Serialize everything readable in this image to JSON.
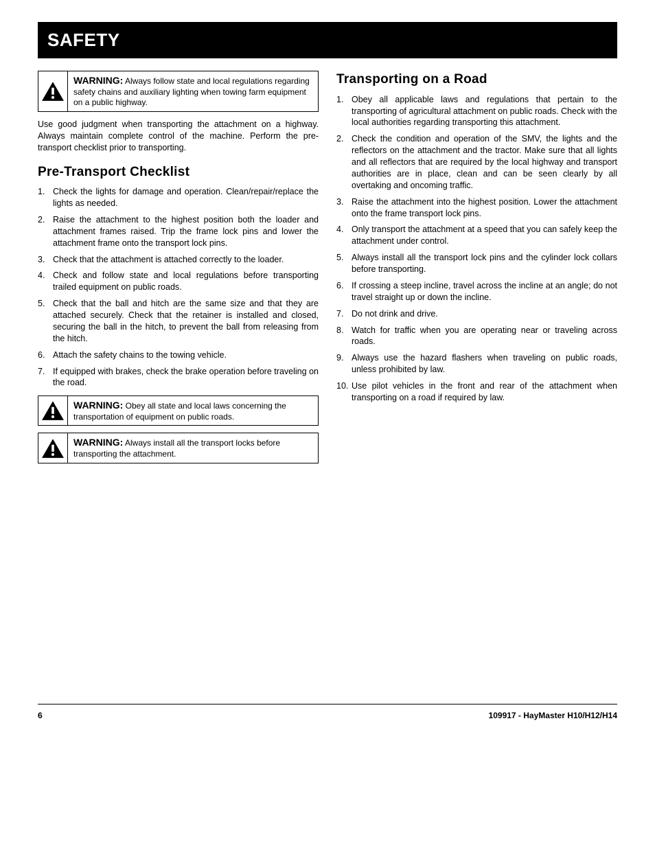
{
  "header": {
    "title": "SAFETY"
  },
  "warn1": {
    "title": "WARNING:",
    "body": "Always follow state and local regulations regarding safety chains and auxiliary lighting when towing farm equipment on a public highway."
  },
  "intro": "Use good judgment when transporting the attachment on a highway. Always maintain complete control of the machine. Perform the pre-transport checklist prior to transporting.",
  "section1": {
    "heading": "Pre-Transport Checklist",
    "items": [
      "Check the lights for damage and operation. Clean/repair/replace the lights as needed.",
      "Raise the attachment to the highest position both the loader and attachment frames raised. Trip the frame lock pins and lower the attachment frame onto the transport lock pins.",
      "Check that the attachment is attached correctly to the loader.",
      "Check and follow state and local regulations before transporting trailed equipment on public roads.",
      "Check that the ball and hitch are the same size and that they are attached securely. Check that the retainer is installed and closed, securing the ball in the hitch, to prevent the ball from releasing from the hitch.",
      "Attach the safety chains to the towing vehicle.",
      "If equipped with brakes, check the brake operation before traveling on the road."
    ]
  },
  "warn2": {
    "title": "WARNING:",
    "body": "Obey all state and local laws concerning the transportation of equipment on public roads."
  },
  "warn3": {
    "title": "WARNING:",
    "body": "Always install all the transport locks before transporting the attachment."
  },
  "section2": {
    "heading": "Transporting on a Road",
    "items": [
      "Obey all applicable laws and regulations that pertain to the transporting of agricultural attachment on public roads. Check with the local authorities regarding transporting this attachment.",
      "Check the condition and operation of the SMV, the lights and the reflectors on the attachment and the tractor. Make sure that all lights and all reflectors that are required by the local highway and transport authorities are in place, clean and can be seen clearly by all overtaking and oncoming traffic.",
      "Raise the attachment into the highest position. Lower the attachment onto the frame transport lock pins.",
      "Only transport the attachment at a speed that you can safely keep the attachment under control.",
      "Always install all the transport lock pins and the cylinder lock collars before transporting.",
      "If crossing a steep incline, travel across the incline at an angle; do not travel straight up or down the incline.",
      "Do not drink and drive.",
      "Watch for traffic when you are operating near or traveling across roads.",
      "Always use the hazard flashers when traveling on public roads, unless prohibited by law.",
      "Use pilot vehicles in the front and rear of the attachment when transporting on a road if required by law."
    ]
  },
  "footer": {
    "page": "6",
    "doc": "109917 - HayMaster H10/H12/H14"
  }
}
